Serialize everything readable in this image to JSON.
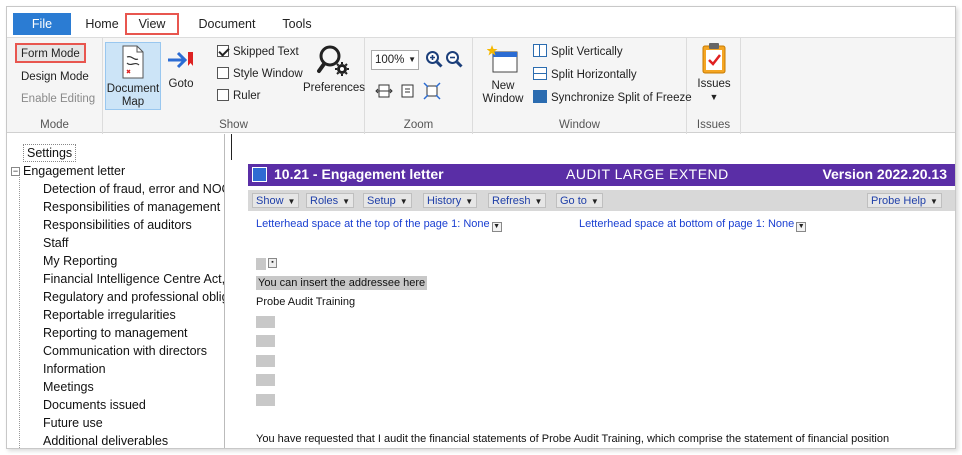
{
  "tabs": {
    "file": "File",
    "home": "Home",
    "view": "View",
    "document": "Document",
    "tools": "Tools"
  },
  "ribbon": {
    "mode": {
      "form_mode": "Form Mode",
      "design_mode": "Design Mode",
      "enable_editing": "Enable Editing",
      "label": "Mode"
    },
    "show": {
      "document_map_line1": "Document",
      "document_map_line2": "Map",
      "goto": "Goto",
      "skipped_text": "Skipped Text",
      "style_window": "Style Window",
      "ruler": "Ruler",
      "preferences": "Preferences",
      "label": "Show",
      "skipped_text_checked": true,
      "style_window_checked": false,
      "ruler_checked": false
    },
    "zoom": {
      "value": "100%",
      "label": "Zoom"
    },
    "window": {
      "new_window_line1": "New",
      "new_window_line2": "Window",
      "split_vertically": "Split Vertically",
      "split_horizontally": "Split Horizontally",
      "synchronize_split": "Synchronize Split of Freeze",
      "label": "Window"
    },
    "issues": {
      "button": "Issues",
      "label": "Issues"
    }
  },
  "tree": {
    "settings": "Settings",
    "root": "Engagement letter",
    "children": [
      "Detection of fraud, error and NOC",
      "Responsibilities of management",
      "Responsibilities of auditors",
      "Staff",
      "My Reporting",
      "Financial Intelligence Centre Act,",
      "Regulatory and professional oblig",
      "Reportable irregularities",
      "Reporting to management",
      "Communication with directors",
      "Information",
      "Meetings",
      "Documents issued",
      "Future use",
      "Additional deliverables"
    ]
  },
  "document": {
    "title": "10.21 - Engagement letter",
    "product": "AUDIT LARGE EXTEND",
    "version": "Version 2022.20.13",
    "menu": [
      "Show",
      "Roles",
      "Setup",
      "History",
      "Refresh",
      "Go to"
    ],
    "probe_help": "Probe Help",
    "letterhead_top": "Letterhead space at the top of the page 1: None",
    "letterhead_bottom": "Letterhead space at bottom of page 1: None",
    "addressee": "You can insert the addressee here",
    "client": "Probe Audit Training",
    "paragraph": "You have requested that I audit the financial statements of Probe Audit Training, which comprise the statement of financial position and the statement of comprehensive income, statement of changes in equity and statement of cash flows, and notes to the financial statements"
  },
  "colors": {
    "file_tab": "#2b7cd3",
    "highlight": "#e8564f",
    "title_bar": "#5a2ea6",
    "link_blue": "#1a3fd1"
  }
}
